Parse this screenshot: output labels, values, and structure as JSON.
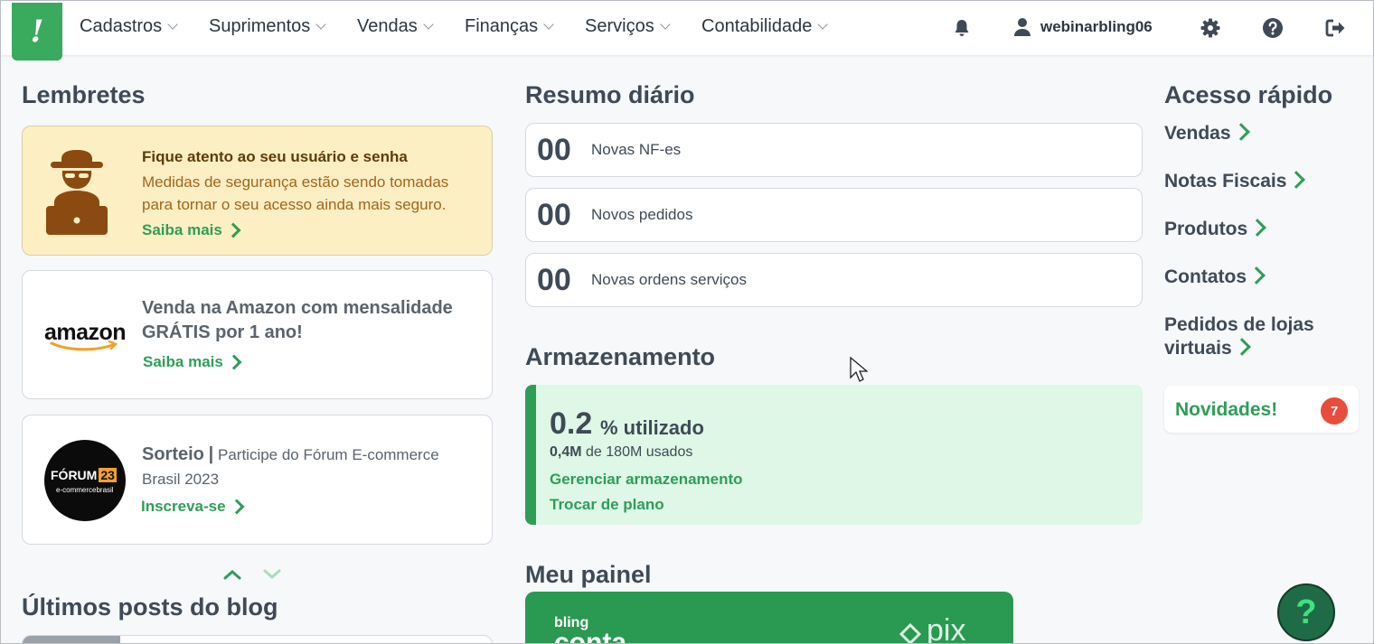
{
  "nav": {
    "logo_text": "!",
    "menu": [
      "Cadastros",
      "Suprimentos",
      "Vendas",
      "Finanças",
      "Serviços",
      "Contabilidade"
    ],
    "username": "webinarbling06",
    "icons": [
      "bell-icon",
      "user-icon",
      "gear-icon",
      "help-circle-icon",
      "logout-icon"
    ]
  },
  "reminders": {
    "title": "Lembretes",
    "security": {
      "title": "Fique atento ao seu usuário e senha",
      "body": "Medidas de segurança estão sendo tomadas para tornar o seu acesso ainda mais seguro.",
      "link": "Saiba mais"
    },
    "amazon": {
      "logo": "amazon",
      "title": "Venda na Amazon com mensalidade GRÁTIS por 1 ano!",
      "link": "Saiba mais"
    },
    "forum": {
      "logo_text": "FÓRUM",
      "logo_year": "23",
      "logo_sub": "e-commercebrasil",
      "title": "Sorteio",
      "separator": "|",
      "body": "Participe do Fórum E-commerce Brasil 2023",
      "link": "Inscreva-se"
    }
  },
  "blog": {
    "title": "Últimos posts do blog"
  },
  "summary": {
    "title": "Resumo diário",
    "items": [
      {
        "count": "00",
        "label": "Novas NF-es"
      },
      {
        "count": "00",
        "label": "Novos pedidos"
      },
      {
        "count": "00",
        "label": "Novas ordens serviços"
      }
    ]
  },
  "storage": {
    "title": "Armazenamento",
    "percent": "0.2",
    "percent_label": "% utilizado",
    "used": "0,4M",
    "of_label": "de 180M usados",
    "manage_link": "Gerenciar armazenamento",
    "plan_link": "Trocar de plano"
  },
  "panel": {
    "title": "Meu painel",
    "brand_small": "bling",
    "brand_big": "conta",
    "pix": "pix"
  },
  "quick_access": {
    "title": "Acesso rápido",
    "items": [
      "Vendas",
      "Notas Fiscais",
      "Produtos",
      "Contatos",
      "Pedidos de lojas virtuais"
    ]
  },
  "news": {
    "label": "Novidades!",
    "count": "7"
  },
  "help_label": "?",
  "colors": {
    "green": "#2e9e57",
    "warn_bg": "#fdefc4",
    "badge": "#e84c3d",
    "storage_bg": "#def7e6"
  }
}
